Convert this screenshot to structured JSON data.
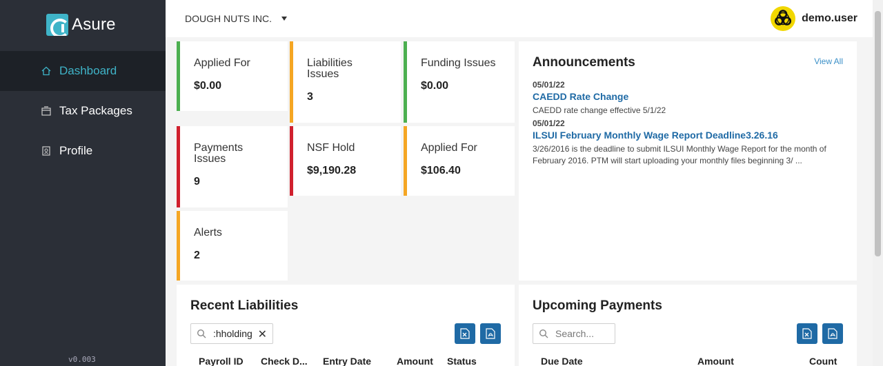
{
  "app": {
    "logo_text": "Asure",
    "version": "v0.003"
  },
  "sidebar": {
    "items": [
      {
        "label": "Dashboard",
        "icon": "home-icon"
      },
      {
        "label": "Tax Packages",
        "icon": "package-icon"
      },
      {
        "label": "Profile",
        "icon": "profile-icon"
      }
    ]
  },
  "topbar": {
    "company": "DOUGH NUTS INC.",
    "username": "demo.user",
    "avatar_icon": "biohazard-icon"
  },
  "stats": [
    {
      "label_lines": [
        "Applied For"
      ],
      "value": "$0.00",
      "accent": "#4caf50"
    },
    {
      "label_lines": [
        "Liabilities",
        "Issues"
      ],
      "value": "3",
      "accent": "#f5a623"
    },
    {
      "label_lines": [
        "Funding Issues"
      ],
      "value": "$0.00",
      "accent": "#4caf50"
    },
    {
      "label_lines": [
        "Payments",
        "Issues"
      ],
      "value": "9",
      "accent": "#d0202e"
    },
    {
      "label_lines": [
        "NSF Hold"
      ],
      "value": "$9,190.28",
      "accent": "#d0202e"
    },
    {
      "label_lines": [
        "Applied For"
      ],
      "value": "$106.40",
      "accent": "#f5a623"
    },
    {
      "label_lines": [
        "Alerts"
      ],
      "value": "2",
      "accent": "#f5a623"
    }
  ],
  "announcements": {
    "title": "Announcements",
    "view_all": "View All",
    "items": [
      {
        "date": "05/01/22",
        "title": "CAEDD Rate Change",
        "body": "CAEDD rate change effective 5/1/22"
      },
      {
        "date": "05/01/22",
        "title": "ILSUI February Monthly Wage Report Deadline3.26.16",
        "body": "3/26/2016 is the deadline to submit ILSUI Monthly Wage Report for the month of February 2016. PTM will start uploading your monthly files beginning 3/ ..."
      }
    ]
  },
  "recent_liabilities": {
    "title": "Recent Liabilities",
    "search_value": ":hholding",
    "columns": [
      "Payroll ID",
      "Check D...",
      "Entry Date",
      "Amount",
      "Status"
    ]
  },
  "upcoming_payments": {
    "title": "Upcoming Payments",
    "search_placeholder": "Search...",
    "columns": [
      "Due Date",
      "Amount",
      "Count"
    ]
  },
  "colors": {
    "sidebar_bg": "#2b2f37",
    "sidebar_active_bg": "#1d2127",
    "accent": "#3fb4c8",
    "link": "#1f6aa5"
  }
}
